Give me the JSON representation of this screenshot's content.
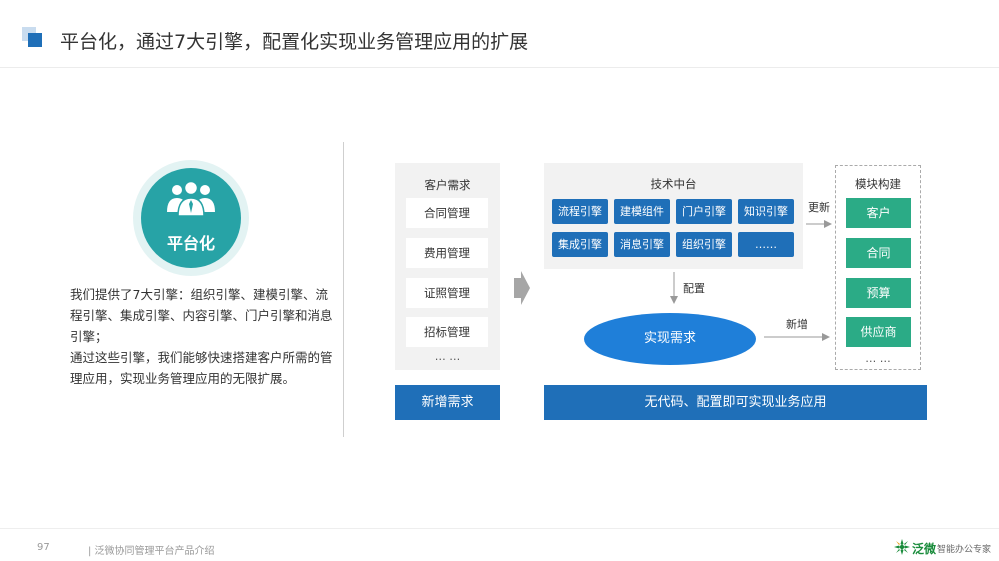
{
  "header": {
    "title": "平台化，通过7大引擎，配置化实现业务管理应用的扩展"
  },
  "left": {
    "badge_label": "平台化",
    "description": [
      "我们提供了7大引擎：组织引擎、建模引擎、流程引擎、集成引擎、内容引擎、门户引擎和消息引擎；",
      "通过这些引擎，我们能够快速搭建客户所需的管理应用，实现业务管理应用的无限扩展。"
    ]
  },
  "diagram": {
    "customer_needs": {
      "title": "客户需求",
      "items": [
        "合同管理",
        "费用管理",
        "证照管理",
        "招标管理"
      ],
      "more": "… …",
      "bottom_label": "新增需求"
    },
    "tech_platform": {
      "title": "技术中台",
      "engines_row1": [
        "流程引擎",
        "建模组件",
        "门户引擎",
        "知识引擎"
      ],
      "engines_row2": [
        "集成引擎",
        "消息引擎",
        "组织引擎",
        "……"
      ]
    },
    "config_label": "配置",
    "update_label": "更新",
    "add_label": "新增",
    "realize_label": "实现需求",
    "bottom_label": "无代码、配置即可实现业务应用",
    "modules": {
      "title": "模块构建",
      "items": [
        "客户",
        "合同",
        "预算",
        "供应商"
      ],
      "more": "… …"
    }
  },
  "footer": {
    "page_number": "97",
    "text": "| 泛微协同管理平台产品介绍",
    "logo_text": "泛微",
    "slogan": "智能办公专家"
  },
  "colors": {
    "primary_blue": "#1f6fb8",
    "ellipse_blue": "#1f7fd9",
    "teal": "#27a3a6",
    "green": "#2bab86",
    "panel_gray": "#f2f2f2"
  }
}
